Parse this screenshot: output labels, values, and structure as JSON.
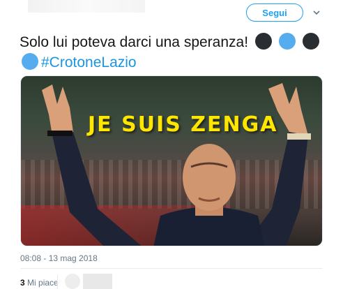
{
  "header": {
    "follow_label": "Segui",
    "caret_icon": "chevron-down-icon"
  },
  "tweet": {
    "text": "Solo lui poteva darci una speranza!",
    "emoji_row1": [
      "black-circle",
      "blue-circle",
      "black-circle"
    ],
    "emoji_row2": [
      "blue-circle"
    ],
    "hashtag": "#CrotoneLazio",
    "photo_caption": "JE SUIS ZENGA",
    "timestamp": "08:08 - 13 mag 2018"
  },
  "stats": {
    "likes_count": "3",
    "likes_label": "Mi piace"
  },
  "colors": {
    "accent": "#1da1f2",
    "hashtag": "#1b95e0",
    "caption_yellow": "#ffe600",
    "emoji_black": "#2a2d31",
    "emoji_blue": "#55acee"
  }
}
